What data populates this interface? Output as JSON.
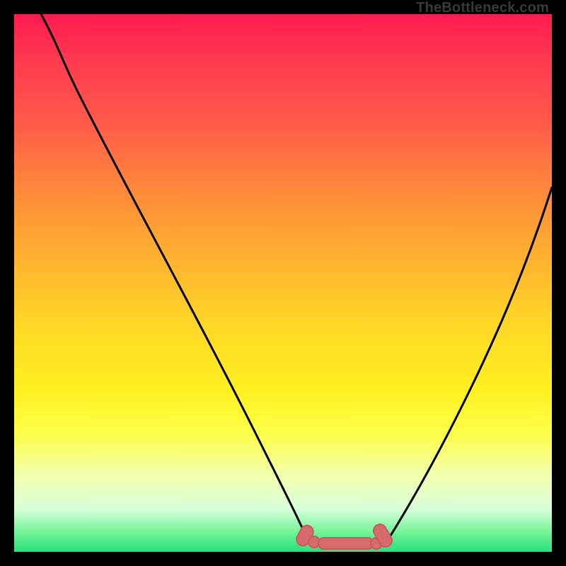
{
  "watermark": "TheBottleneck.com",
  "colors": {
    "frame": "#000000",
    "curve_stroke": "#000000",
    "marker_fill": "#d76a6a",
    "marker_stroke": "#c95a5a"
  },
  "chart_data": {
    "type": "line",
    "title": "",
    "xlabel": "",
    "ylabel": "",
    "xlim": [
      0,
      100
    ],
    "ylim": [
      0,
      100
    ],
    "note": "Axes are unlabeled; values are normalized 0–100 estimated from pixel positions. y=0 is bottom, y=100 is top.",
    "series": [
      {
        "name": "left-curve",
        "x": [
          5,
          10,
          15,
          20,
          25,
          30,
          35,
          40,
          45,
          50,
          54
        ],
        "y": [
          100,
          92,
          82,
          72,
          62,
          52,
          41,
          30,
          19,
          9,
          3
        ]
      },
      {
        "name": "right-curve",
        "x": [
          70,
          74,
          78,
          82,
          86,
          90,
          94,
          98,
          100
        ],
        "y": [
          3,
          7,
          13,
          21,
          30,
          40,
          51,
          62,
          68
        ]
      },
      {
        "name": "bottom-markers",
        "x": [
          54,
          56,
          59,
          62,
          65,
          68,
          70
        ],
        "y": [
          3,
          2,
          1.7,
          1.6,
          1.7,
          2.1,
          3
        ]
      }
    ]
  }
}
